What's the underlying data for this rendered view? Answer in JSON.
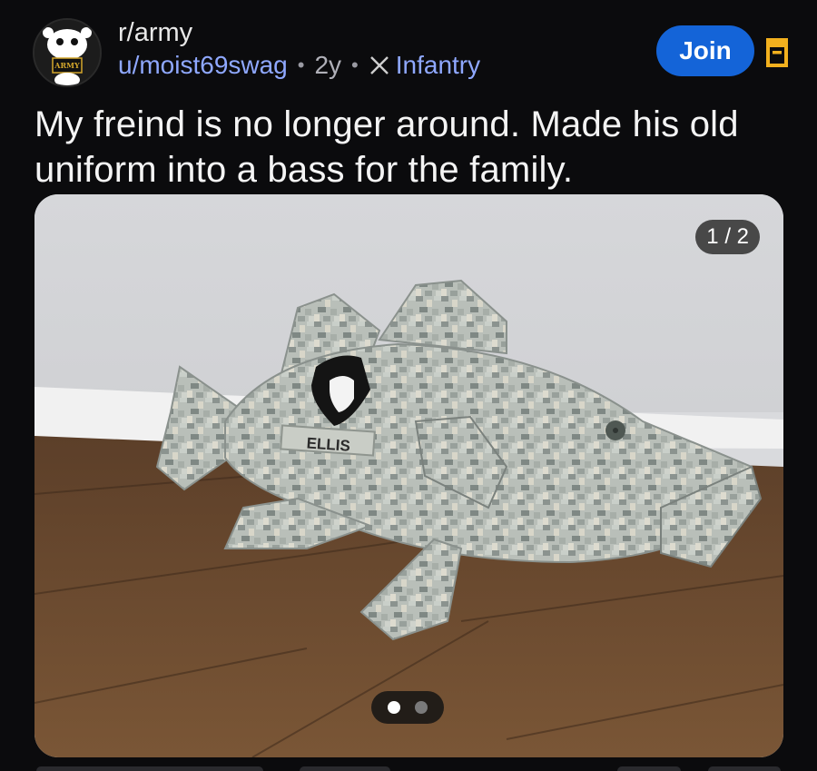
{
  "header": {
    "subreddit": "r/army",
    "username": "u/moist69swag",
    "age": "2y",
    "flair": "Infantry",
    "join_label": "Join",
    "avatar_badge_text": "ARMY"
  },
  "post": {
    "title": "My freind is no longer around. Made his old uniform into a bass for the family."
  },
  "media": {
    "counter": "1 / 2",
    "name_tape": "ELLIS",
    "current_page": 1,
    "total_pages": 2
  },
  "colors": {
    "background": "#0b0b0d",
    "accent": "#1464d8",
    "link": "#8fa8ff",
    "save_icon": "#f2b01e"
  }
}
